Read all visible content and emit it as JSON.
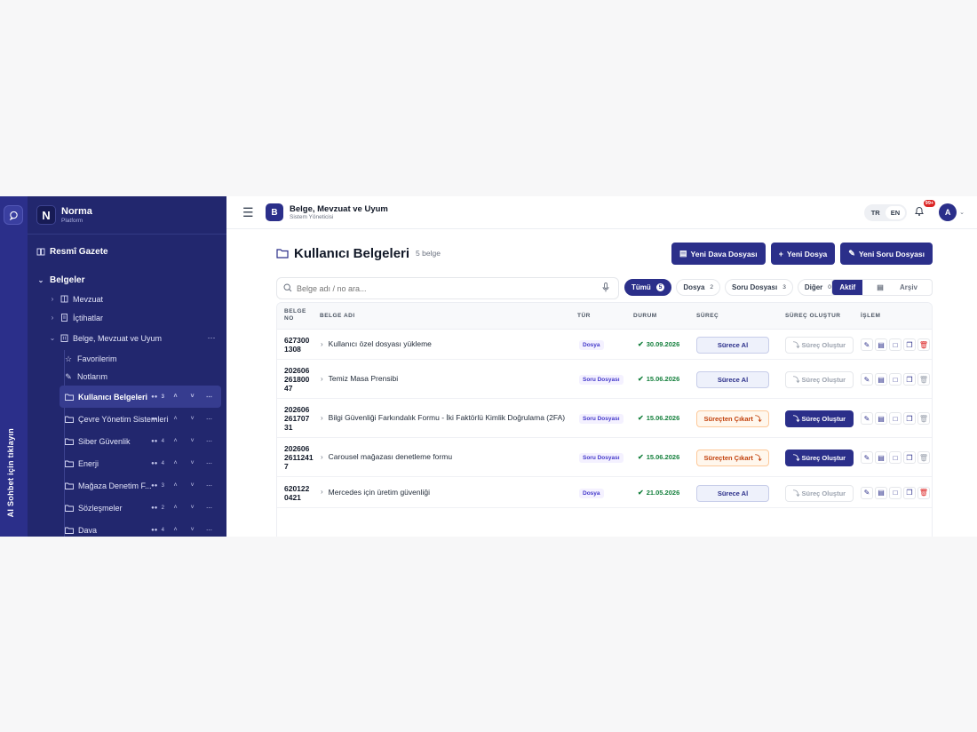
{
  "ai_rail": {
    "label": "AI Sohbet için tıklayın"
  },
  "brand": {
    "logo": "N",
    "name": "Norma",
    "sub": "Platform"
  },
  "sidebar": {
    "resmi_gazete": "Resmî Gazete",
    "belgeler": "Belgeler",
    "items": [
      {
        "label": "Mevzuat",
        "icon": "book-icon"
      },
      {
        "label": "İçtihatlar",
        "icon": "document-icon"
      },
      {
        "label": "Belge, Mevzuat ve Uyum",
        "icon": "building-icon"
      }
    ],
    "leaves": [
      {
        "label": "Favorilerim",
        "icon": "star-icon"
      },
      {
        "label": "Notlarım",
        "icon": "pencil-icon"
      }
    ],
    "folders": [
      {
        "label": "Kullanıcı Belgeleri",
        "count": "3",
        "active": true
      },
      {
        "label": "Çevre Yönetim Sistemleri",
        "count": ""
      },
      {
        "label": "Siber Güvenlik",
        "count": "4"
      },
      {
        "label": "Enerji",
        "count": "4"
      },
      {
        "label": "Mağaza Denetim F...",
        "count": "3"
      },
      {
        "label": "Sözleşmeler",
        "count": "2"
      },
      {
        "label": "Dava",
        "count": "4"
      }
    ]
  },
  "topbar": {
    "badge": "B",
    "title": "Belge, Mevzuat ve Uyum",
    "subtitle": "Sistem Yöneticisi",
    "lang_tr": "TR",
    "lang_en": "EN",
    "notif_count": "99+",
    "avatar": "A"
  },
  "page": {
    "title": "Kullanıcı Belgeleri",
    "count": "5 belge",
    "btn_dava": "Yeni Dava Dosyası",
    "btn_dosya": "Yeni Dosya",
    "btn_soru": "Yeni Soru Dosyası"
  },
  "search": {
    "placeholder": "Belge adı / no ara..."
  },
  "chips": [
    {
      "label": "Tümü",
      "count": "5",
      "active": true
    },
    {
      "label": "Dosya",
      "count": "2"
    },
    {
      "label": "Soru Dosyası",
      "count": "3"
    },
    {
      "label": "Diğer",
      "count": "0"
    }
  ],
  "segment": {
    "active": "Aktif",
    "archive": "Arşiv"
  },
  "table": {
    "headers": {
      "no": "BELGE NO",
      "name": "BELGE ADI",
      "type": "TÜR",
      "status": "DURUM",
      "process": "SÜREÇ",
      "create": "SÜREÇ OLUŞTUR",
      "action": "İŞLEM"
    },
    "rows": [
      {
        "no1": "627300",
        "no2": "1308",
        "no3": "",
        "name": "Kullanıcı özel dosyası yükleme",
        "type": "Dosya",
        "date": "30.09.2026",
        "process": "Sürece Al",
        "process_kind": "ai",
        "create": "Süreç Oluştur",
        "create_on": false,
        "del_red": true
      },
      {
        "no1": "202606",
        "no2": "261800",
        "no3": "47",
        "name": "Temiz Masa Prensibi",
        "type": "Soru Dosyası",
        "date": "15.06.2026",
        "process": "Sürece Al",
        "process_kind": "ai",
        "create": "Süreç Oluştur",
        "create_on": false,
        "del_red": false
      },
      {
        "no1": "202606",
        "no2": "261707",
        "no3": "31",
        "name": "Bilgi Güvenliği Farkındalık Formu - İki Faktörlü Kimlik Doğrulama (2FA)",
        "type": "Soru Dosyası",
        "date": "15.06.2026",
        "process": "Süreçten Çıkart",
        "process_kind": "out",
        "create": "Süreç Oluştur",
        "create_on": true,
        "del_red": false
      },
      {
        "no1": "202606",
        "no2": "2611241",
        "no3": "7",
        "name": "Carousel mağazası denetleme formu",
        "type": "Soru Dosyası",
        "date": "15.06.2026",
        "process": "Süreçten Çıkart",
        "process_kind": "out",
        "create": "Süreç Oluştur",
        "create_on": true,
        "del_red": false
      },
      {
        "no1": "620122",
        "no2": "0421",
        "no3": "",
        "name": "Mercedes için üretim güvenliği",
        "type": "Dosya",
        "date": "21.05.2026",
        "process": "Sürece Al",
        "process_kind": "ai",
        "create": "Süreç Oluştur",
        "create_on": false,
        "del_red": true
      }
    ]
  }
}
